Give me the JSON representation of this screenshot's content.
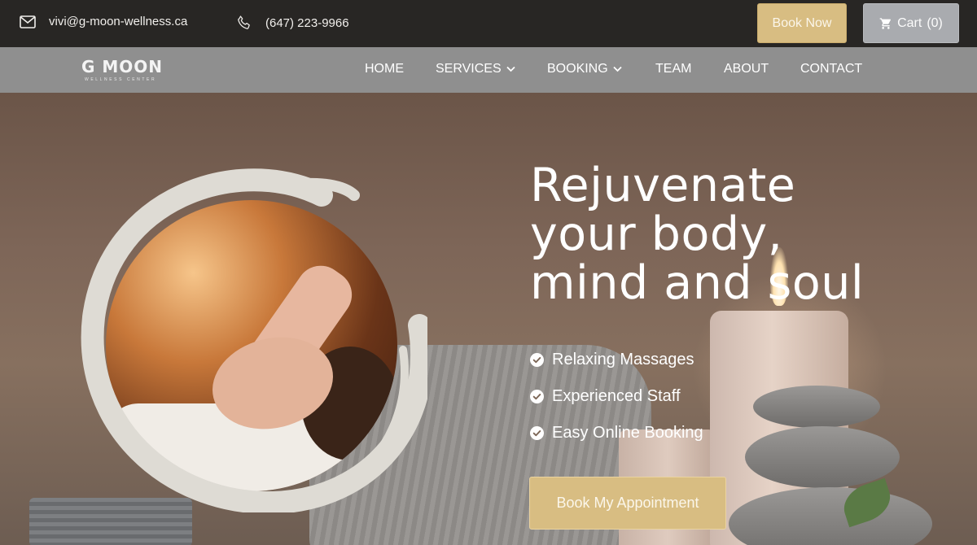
{
  "topbar": {
    "email": "vivi@g-moon-wellness.ca",
    "phone": "(647) 223-9966",
    "email_icon": "mail-icon",
    "phone_icon": "phone-icon",
    "book_now_label": "Book Now",
    "cart_label": "Cart",
    "cart_count": "(0)",
    "cart_icon": "cart-icon",
    "colors": {
      "bar": "#282624",
      "gold": "#d8bd82",
      "cart": "#a9abaf"
    }
  },
  "nav": {
    "logo_text": "G MOON",
    "logo_subtext": "WELLNESS CENTER",
    "items": [
      {
        "label": "HOME",
        "has_dropdown": false
      },
      {
        "label": "SERVICES",
        "has_dropdown": true
      },
      {
        "label": "BOOKING",
        "has_dropdown": true
      },
      {
        "label": "TEAM",
        "has_dropdown": false
      },
      {
        "label": "ABOUT",
        "has_dropdown": false
      },
      {
        "label": "CONTACT",
        "has_dropdown": false
      }
    ],
    "dropdown_icon": "chevron-down-icon",
    "colors": {
      "bar": "#8f8f8f"
    }
  },
  "hero": {
    "headline_lines": [
      "Rejuvenate",
      "your body,",
      "mind and soul"
    ],
    "features": [
      "Relaxing Massages",
      "Experienced Staff",
      "Easy Online Booking"
    ],
    "feature_icon": "check-circle-icon",
    "cta_label": "Book My Appointment",
    "photo_icon": "massage-photo"
  }
}
